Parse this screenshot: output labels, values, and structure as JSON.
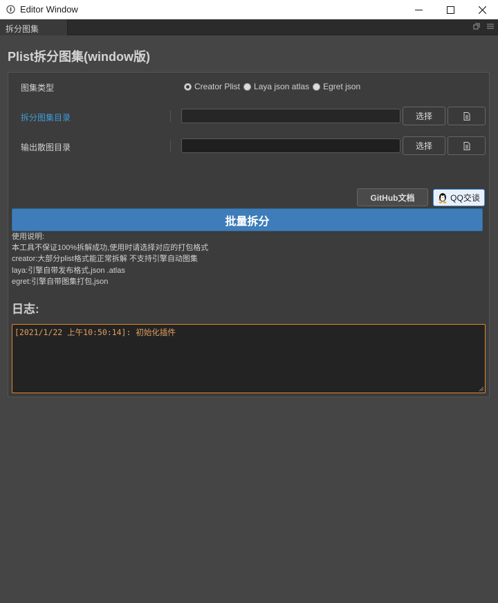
{
  "window": {
    "title": "Editor Window",
    "controls": [
      "minimize",
      "maximize",
      "close"
    ]
  },
  "tabs": [
    {
      "label": "拆分图集",
      "active": true
    }
  ],
  "page": {
    "title": "Plist拆分图集(window版)"
  },
  "form": {
    "atlas_type": {
      "label": "图集类型",
      "options": [
        {
          "label": "Creator Plist",
          "selected": true
        },
        {
          "label": "Laya json atlas",
          "selected": false
        },
        {
          "label": "Egret json",
          "selected": false
        }
      ]
    },
    "split_dir": {
      "label": "拆分图集目录",
      "value": "",
      "choose_label": "选择",
      "open_icon": "file-icon"
    },
    "output_dir": {
      "label": "输出散图目录",
      "value": "",
      "choose_label": "选择",
      "open_icon": "file-icon"
    }
  },
  "links": {
    "github_label": "GitHub文档",
    "qq_label": "QQ交谈",
    "qq_icon": "qq-penguin-icon"
  },
  "action": {
    "batch_split_label": "批量拆分"
  },
  "notes": [
    "使用说明:",
    "本工具不保证100%拆解成功,使用时请选择对应的打包格式",
    "creator:大部分plist格式能正常拆解 不支持引擎自动图集",
    "laya:引擎自带发布格式,json .atlas",
    "egret:引擎自带图集打包,json"
  ],
  "log": {
    "title": "日志:",
    "content": "[2021/1/22 上午10:50:14]: 初始化插件"
  },
  "colors": {
    "accent_blue": "#3e7db9",
    "label_blue": "#3f9bd6",
    "log_border": "#e08a2a",
    "log_text": "#e0a060"
  }
}
